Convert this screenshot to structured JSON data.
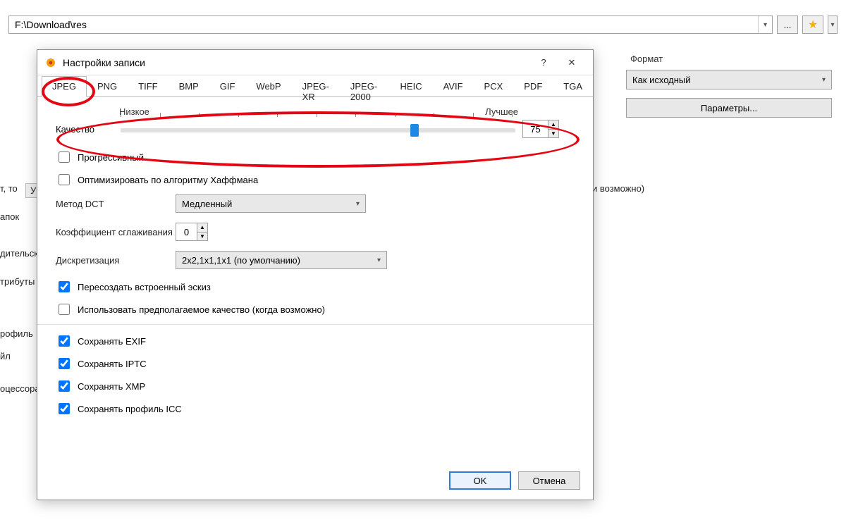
{
  "address": {
    "path": "F:\\Download\\res"
  },
  "toolbar": {
    "ellipsis": "...",
    "star_aria": "favorites"
  },
  "right_panel": {
    "group_label": "Формат",
    "format_value": "Как исходный",
    "params_button": "Параметры..."
  },
  "bg_scraps": {
    "s1": "т, то",
    "s2": "апок",
    "s3": "дительск",
    "s4": "трибуты",
    "s5": "рофиль",
    "s6": "йл",
    "s7": "оцессора",
    "s8": "У",
    "s9": "и возможно)"
  },
  "dialog": {
    "title": "Настройки записи",
    "help": "?",
    "tabs": [
      "JPEG",
      "PNG",
      "TIFF",
      "BMP",
      "GIF",
      "WebP",
      "JPEG-XR",
      "JPEG-2000",
      "HEIC",
      "AVIF",
      "PCX",
      "PDF",
      "TGA"
    ],
    "active_tab": 0,
    "quality": {
      "low_label": "Низкое",
      "high_label": "Лучшее",
      "label": "Качество",
      "value": "75"
    },
    "progressive": {
      "label": "Прогрессивный",
      "checked": false
    },
    "huffman": {
      "label": "Оптимизировать по алгоритму Хаффмана",
      "checked": false
    },
    "dct": {
      "label": "Метод DCT",
      "value": "Медленный"
    },
    "smoothing": {
      "label": "Коэффициент сглаживания",
      "value": "0"
    },
    "subsampling": {
      "label": "Дискретизация",
      "value": "2x2,1x1,1x1 (по умолчанию)"
    },
    "rebuild_thumb": {
      "label": "Пересоздать встроенный эскиз",
      "checked": true
    },
    "use_estimated": {
      "label": "Использовать предполагаемое качество (когда возможно)",
      "checked": false
    },
    "keep_exif": {
      "label": "Сохранять EXIF",
      "checked": true
    },
    "keep_iptc": {
      "label": "Сохранять IPTC",
      "checked": true
    },
    "keep_xmp": {
      "label": "Сохранять XMP",
      "checked": true
    },
    "keep_icc": {
      "label": "Сохранять профиль ICC",
      "checked": true
    },
    "ok": "OK",
    "cancel": "Отмена"
  }
}
